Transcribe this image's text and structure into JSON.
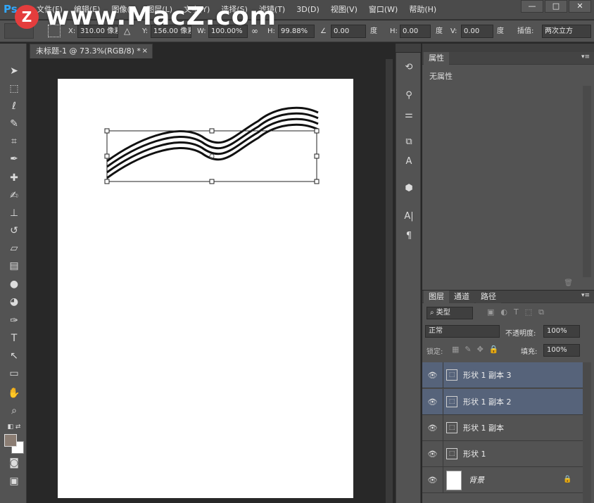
{
  "menubar": {
    "logo": "Ps",
    "items": [
      "文件(F)",
      "编辑(E)",
      "图像(I)",
      "图层(L)",
      "文字(Y)",
      "选择(S)",
      "滤镜(T)",
      "3D(D)",
      "视图(V)",
      "窗口(W)",
      "帮助(H)"
    ],
    "window_controls": [
      "—",
      "□",
      "✕"
    ]
  },
  "watermark": {
    "badge": "Z",
    "text": "www.MacZ.com"
  },
  "options": {
    "x_label": "X:",
    "x_value": "310.00 像素",
    "y_label": "Y:",
    "y_value": "156.00 像素",
    "w_label": "W:",
    "w_value": "100.00%",
    "h_label": "H:",
    "h_value": "99.88%",
    "angle_value": "0.00",
    "angle_unit": "度",
    "hskew_label": "H:",
    "hskew_value": "0.00",
    "hskew_unit": "度",
    "vskew_label": "V:",
    "vskew_value": "0.00",
    "vskew_unit": "度",
    "interp_label": "插值:",
    "interp_value": "两次立方"
  },
  "document": {
    "tab_title": "未标题-1 @ 73.3%(RGB/8) *",
    "tab_close": "×"
  },
  "properties": {
    "tab": "属性",
    "body": "无属性"
  },
  "layers_panel": {
    "tabs": [
      "图层",
      "通道",
      "路径"
    ],
    "filter_label": "类型",
    "blend_mode": "正常",
    "opacity_label": "不透明度:",
    "opacity_value": "100%",
    "lock_label": "锁定:",
    "fill_label": "填充:",
    "fill_value": "100%",
    "layers": [
      {
        "name": "形状 1 副本 3",
        "selected": true
      },
      {
        "name": "形状 1 副本 2",
        "selected": true
      },
      {
        "name": "形状 1 副本",
        "selected": false
      },
      {
        "name": "形状 1",
        "selected": false
      },
      {
        "name": "背景",
        "selected": false
      }
    ]
  },
  "colors": {
    "selection": "#56637a",
    "accent": "#31a8ff"
  }
}
